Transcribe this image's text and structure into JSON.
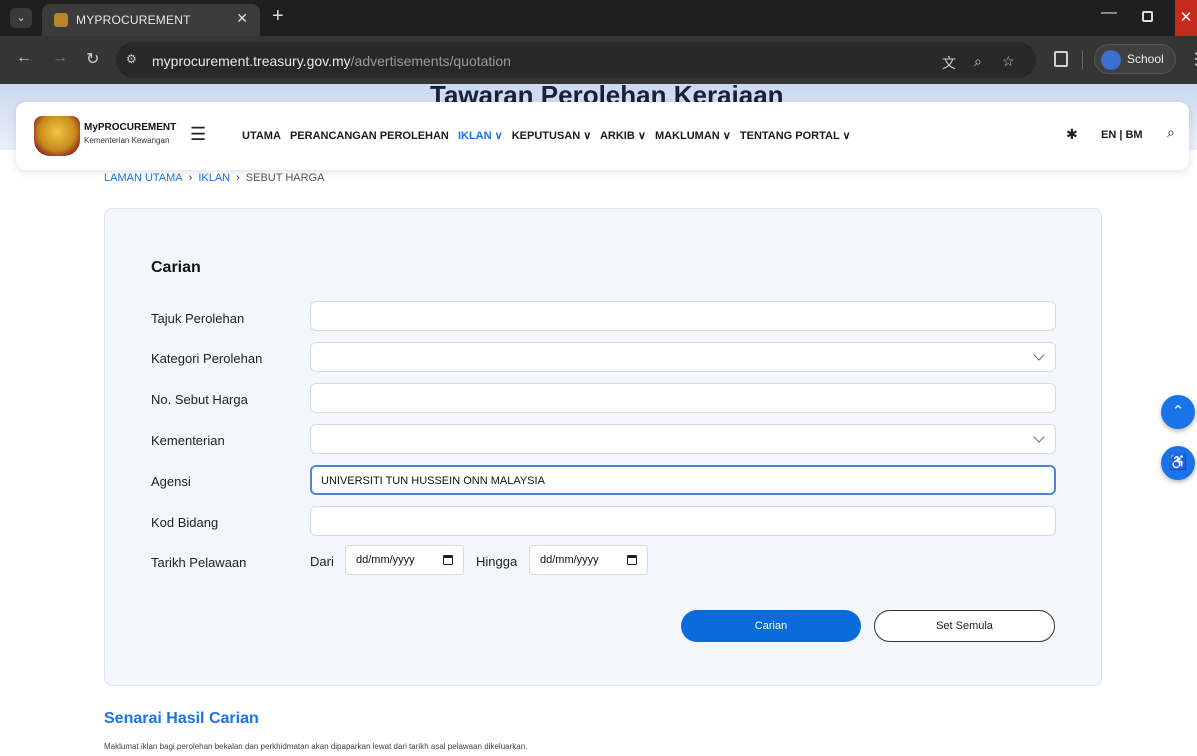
{
  "browser": {
    "tab_title": "MYPROCUREMENT",
    "url_domain": "myprocurement.treasury.gov.my",
    "url_path": "/advertisements/quotation",
    "profile_name": "School"
  },
  "hero": {
    "title": "Tawaran Perolehan Kerajaan"
  },
  "header": {
    "brand": "MyPROCUREMENT",
    "brand_sub": "Kementerian Kewangan",
    "menu": [
      "UTAMA",
      "PERANCANGAN PEROLEHAN",
      "IKLAN ∨",
      "KEPUTUSAN ∨",
      "ARKIB ∨",
      "MAKLUMAN ∨",
      "TENTANG PORTAL ∨"
    ],
    "lang": "EN | BM"
  },
  "breadcrumb": [
    "LAMAN UTAMA",
    "IKLAN",
    "SEBUT HARGA"
  ],
  "search": {
    "title": "Carian",
    "labels": {
      "tajuk": "Tajuk Perolehan",
      "kategori": "Kategori Perolehan",
      "no_sebut": "No. Sebut Harga",
      "kementerian": "Kementerian",
      "agensi": "Agensi",
      "kod_bidang": "Kod Bidang",
      "tarikh": "Tarikh Pelawaan"
    },
    "values": {
      "agensi": "UNIVERSITI TUN HUSSEIN ONN MALAYSIA"
    },
    "date": {
      "from_label": "Dari",
      "to_label": "Hingga",
      "from_value": "dd/mm/yyyy",
      "to_value": "dd/mm/yyyy"
    },
    "buttons": {
      "search": "Carian",
      "reset": "Set Semula"
    }
  },
  "results": {
    "title": "Senarai Hasil Carian",
    "note": "Maklumat iklan bagi perolehan bekalan dan perkhidmatan akan dipaparkan lewat dari tarikh asal pelawaan dikeluarkan."
  },
  "colors": {
    "primary": "#0a6cdb",
    "link": "#1a73e8"
  }
}
